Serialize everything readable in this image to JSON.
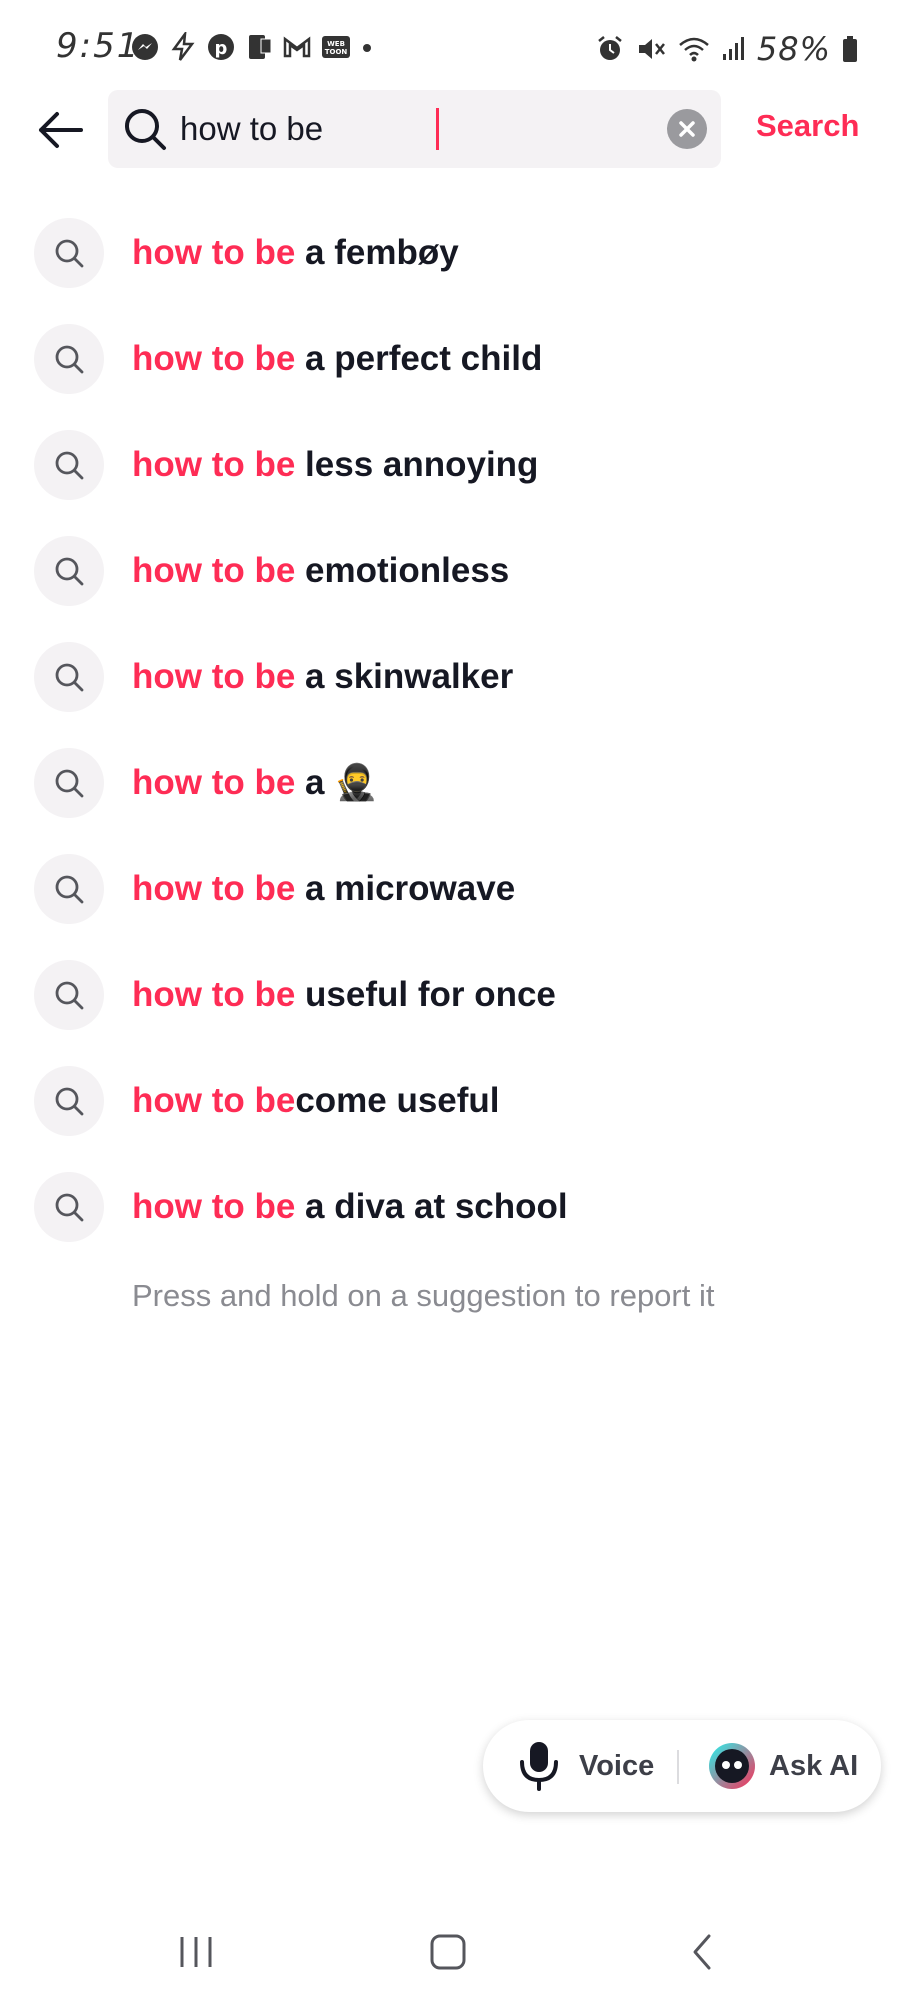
{
  "status_bar": {
    "time": "9:51",
    "battery": "58%"
  },
  "search": {
    "query": "how to be",
    "action_label": "Search"
  },
  "suggestions": [
    {
      "match": "how to be",
      "rest": " a fembøy"
    },
    {
      "match": "how to be",
      "rest": " a perfect child"
    },
    {
      "match": "how to be",
      "rest": " less annoying"
    },
    {
      "match": "how to be",
      "rest": " emotionless"
    },
    {
      "match": "how to be",
      "rest": " a skinwalker"
    },
    {
      "match": "how to be",
      "rest": " a 🥷"
    },
    {
      "match": "how to be",
      "rest": " a microwave"
    },
    {
      "match": "how to be",
      "rest": " useful for once"
    },
    {
      "match": "how to be",
      "rest": "come useful"
    },
    {
      "match": "how to be",
      "rest": " a diva at school"
    }
  ],
  "report_hint": "Press and hold on a suggestion to report it",
  "pill": {
    "voice_label": "Voice",
    "ai_label": "Ask AI"
  },
  "colors": {
    "accent": "#fe2c55",
    "text": "#161823",
    "muted": "#8a8b91"
  },
  "icons": {
    "back": "arrow-left-icon",
    "search": "search-icon",
    "clear": "clear-icon",
    "mic": "microphone-icon",
    "ai": "ask-ai-icon"
  }
}
